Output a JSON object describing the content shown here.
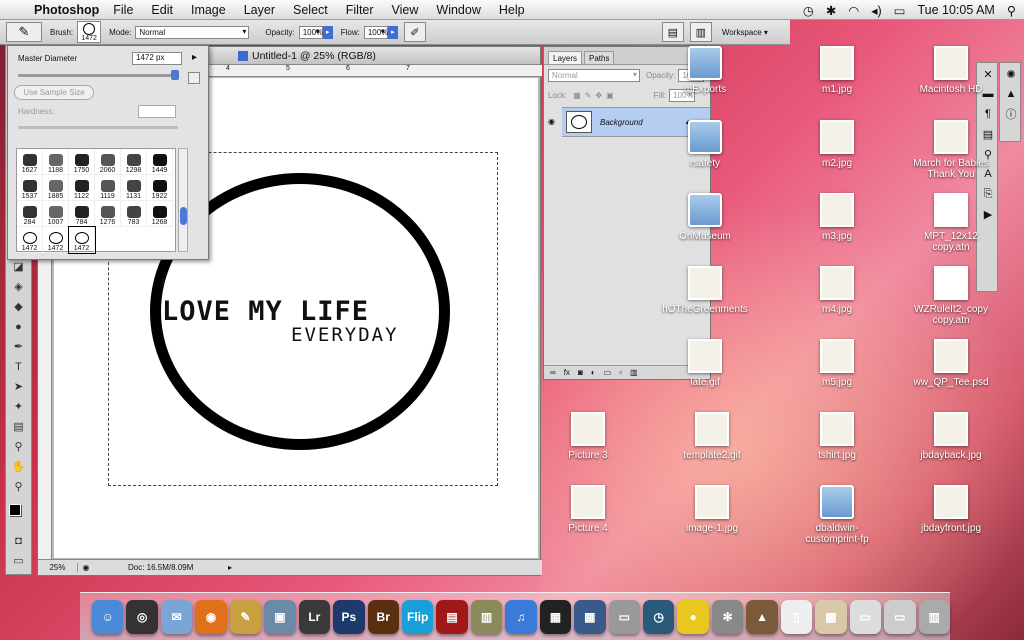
{
  "menubar": {
    "app": "Photoshop",
    "items": [
      "File",
      "Edit",
      "Image",
      "Layer",
      "Select",
      "Filter",
      "View",
      "Window",
      "Help"
    ],
    "clock": "Tue 10:05 AM"
  },
  "options": {
    "brush_label": "Brush:",
    "brush_size": "1472",
    "mode_label": "Mode:",
    "mode_value": "Normal",
    "opacity_label": "Opacity:",
    "opacity_value": "100%",
    "flow_label": "Flow:",
    "flow_value": "100%",
    "workspace": "Workspace ▾"
  },
  "brush_panel": {
    "master_label": "Master Diameter",
    "master_value": "1472 px",
    "sample_button": "Use Sample Size",
    "hardness_label": "Hardness:",
    "presets": [
      "1627",
      "1188",
      "1750",
      "2060",
      "1298",
      "1449",
      "1537",
      "1885",
      "1122",
      "1119",
      "1131",
      "1922",
      "284",
      "1007",
      "784",
      "1276",
      "783",
      "1268",
      "1472",
      "1472",
      "1472"
    ]
  },
  "document": {
    "title": "Untitled-1 @ 25% (RGB/8)",
    "zoom": "25%",
    "doc_info": "Doc: 16.5M/8.09M",
    "text_small": "I",
    "text_main": "LOVE MY LIFE",
    "text_sub": "EVERYDAY",
    "ruler_marks": [
      "1",
      "2",
      "3",
      "4",
      "5",
      "6",
      "7"
    ]
  },
  "layers_panel": {
    "tabs": [
      "Layers",
      "Paths"
    ],
    "blend_mode": "Normal",
    "opacity_label": "Opacity:",
    "opacity_value": "100%",
    "lock_label": "Lock:",
    "fill_label": "Fill:",
    "fill_value": "100%",
    "layer_name": "Background"
  },
  "desktop_icons": [
    {
      "label": "mExports",
      "kind": "folder"
    },
    {
      "label": "m1.jpg",
      "kind": "image"
    },
    {
      "label": "Macintosh HD",
      "kind": "drive"
    },
    {
      "label": "rsafety",
      "kind": "folder"
    },
    {
      "label": "m2.jpg",
      "kind": "image"
    },
    {
      "label": "March for Babies Thank You",
      "kind": "image"
    },
    {
      "label": "OnMuseum",
      "kind": "folder"
    },
    {
      "label": "m3.jpg",
      "kind": "image"
    },
    {
      "label": "MPT_12x12 copy.atn",
      "kind": "action"
    },
    {
      "label": "hOTheGreenments",
      "kind": "image"
    },
    {
      "label": "m4.jpg",
      "kind": "image"
    },
    {
      "label": "WZRuleIt2_copy copy.atn",
      "kind": "action"
    },
    {
      "label": "late.gif",
      "kind": "image"
    },
    {
      "label": "m5.jpg",
      "kind": "image"
    },
    {
      "label": "ww_QP_Tee.psd",
      "kind": "image"
    },
    {
      "label": "Picture 3",
      "kind": "image"
    },
    {
      "label": "template2.gif",
      "kind": "doc"
    },
    {
      "label": "tshirt.jpg",
      "kind": "image"
    },
    {
      "label": "jbdayback.jpg",
      "kind": "image"
    },
    {
      "label": "Picture 4",
      "kind": "image"
    },
    {
      "label": "image-1.jpg",
      "kind": "image"
    },
    {
      "label": "dbaldwin-customprint-fp",
      "kind": "folder"
    },
    {
      "label": "jbdayfront.jpg",
      "kind": "image"
    }
  ],
  "dock": {
    "items": [
      {
        "name": "Finder",
        "glyph": "☺",
        "color": "#4a8ad8"
      },
      {
        "name": "Dashboard",
        "glyph": "◎",
        "color": "#333"
      },
      {
        "name": "Mail",
        "glyph": "✉",
        "color": "#7aa6d6"
      },
      {
        "name": "Firefox",
        "glyph": "◉",
        "color": "#e0701a"
      },
      {
        "name": "Pencil",
        "glyph": "✎",
        "color": "#c8a040"
      },
      {
        "name": "iPhoto",
        "glyph": "▣",
        "color": "#6a8aa8"
      },
      {
        "name": "Lightroom",
        "glyph": "Lr",
        "color": "#3a3a3a"
      },
      {
        "name": "Photoshop",
        "glyph": "Ps",
        "color": "#1e3a6a"
      },
      {
        "name": "Bridge",
        "glyph": "Br",
        "color": "#5a3010"
      },
      {
        "name": "Flip",
        "glyph": "Flip",
        "color": "#1aa0d8"
      },
      {
        "name": "Photo Booth",
        "glyph": "▤",
        "color": "#a01818"
      },
      {
        "name": "Preview",
        "glyph": "▥",
        "color": "#8a8a5a"
      },
      {
        "name": "iTunes",
        "glyph": "♫",
        "color": "#3a7ad8"
      },
      {
        "name": "Clapper",
        "glyph": "▦",
        "color": "#222"
      },
      {
        "name": "Spaces",
        "glyph": "▦",
        "color": "#3a5a8a"
      },
      {
        "name": "Scanner",
        "glyph": "▭",
        "color": "#999"
      },
      {
        "name": "Time Machine",
        "glyph": "◷",
        "color": "#2a5a7a"
      },
      {
        "name": "Duck",
        "glyph": "●",
        "color": "#e8c820"
      },
      {
        "name": "System Preferences",
        "glyph": "✻",
        "color": "#888"
      },
      {
        "name": "Keynote",
        "glyph": "▲",
        "color": "#7a5a3a"
      },
      {
        "name": "Document",
        "glyph": "▯",
        "color": "#eee"
      },
      {
        "name": "Photo",
        "glyph": "▩",
        "color": "#d8c8a8"
      },
      {
        "name": "Screen",
        "glyph": "▭",
        "color": "#ddd"
      },
      {
        "name": "Window",
        "glyph": "▭",
        "color": "#ccc"
      },
      {
        "name": "Trash",
        "glyph": "▥",
        "color": "#aaa"
      }
    ]
  }
}
